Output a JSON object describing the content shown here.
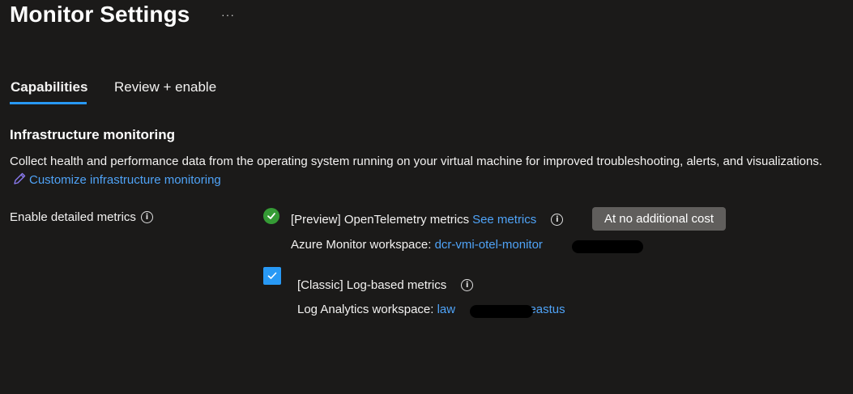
{
  "page": {
    "title": "Monitor Settings",
    "more_glyph": "···"
  },
  "tabs": [
    {
      "label": "Capabilities",
      "active": true
    },
    {
      "label": "Review + enable",
      "active": false
    }
  ],
  "section": {
    "title": "Infrastructure monitoring",
    "description": "Collect health and performance data from the operating system running on your virtual machine for improved troubleshooting, alerts, and visualizations.",
    "customize_link": "Customize infrastructure monitoring"
  },
  "detailed_metrics": {
    "label": "Enable detailed metrics",
    "info_glyph": "i",
    "otel": {
      "label": "[Preview] OpenTelemetry metrics",
      "link": "See metrics",
      "badge": "At no additional cost",
      "workspace_label": "Azure Monitor workspace:",
      "workspace_value": "dcr-vmi-otel-monitor",
      "enabled": true
    },
    "classic": {
      "label": "[Classic] Log-based metrics",
      "workspace_label": "Log Analytics workspace:",
      "workspace_prefix": "law",
      "workspace_suffix": "e-eastus",
      "checked": true
    }
  },
  "colors": {
    "background": "#1b1a19",
    "accent": "#2899f5",
    "link": "#4fa3f7",
    "success": "#359b35",
    "badge": "#605e5c"
  }
}
